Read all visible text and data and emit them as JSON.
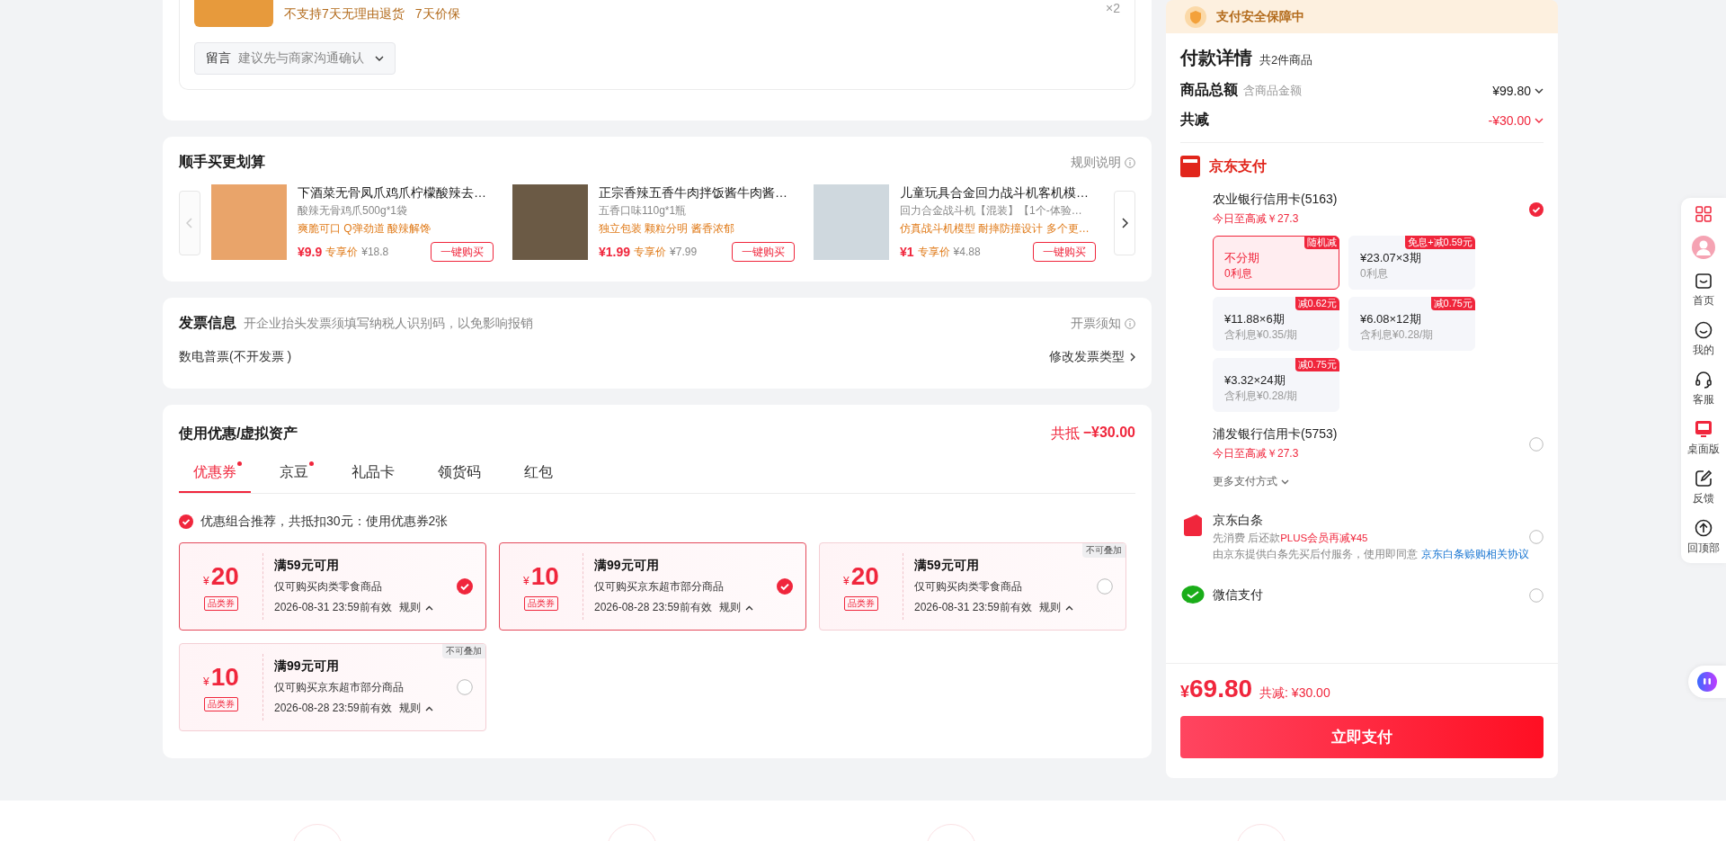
{
  "order_item": {
    "notice": "不支持7天无理由退货",
    "guarantee": "7天价保",
    "quantity": "×2",
    "remark": {
      "label": "留言",
      "placeholder": "建议先与商家沟通确认"
    }
  },
  "addon_deals": {
    "title": "顺手买更划算",
    "rules": "规则说明",
    "prev_enabled": false,
    "next_enabled": true,
    "products": [
      {
        "name": "下酒菜无骨凤爪鸡爪柠檬酸辣去…",
        "spec": "酸辣无骨鸡爪500g*1袋",
        "tags": "爽脆可口 Q弹劲道 酸辣解馋",
        "price": "¥9.9",
        "member_label": "专享价",
        "member_price": "¥18.8",
        "button": "一键购买"
      },
      {
        "name": "正宗香辣五香牛肉拌饭酱牛肉酱…",
        "spec": "五香口味110g*1瓶",
        "tags": "独立包装 颗粒分明 酱香浓郁",
        "price": "¥1.99",
        "member_label": "专享价",
        "member_price": "¥7.99",
        "button": "一键购买"
      },
      {
        "name": "儿童玩具合金回力战斗机客机模…",
        "spec": "回力合金战斗机【混装】【1个-体验…",
        "tags": "仿真战斗机模型 耐摔防撞设计 多个更…",
        "price": "¥1",
        "member_label": "专享价",
        "member_price": "¥4.88",
        "button": "一键购买"
      }
    ]
  },
  "invoice": {
    "title": "发票信息",
    "hint": "开企业抬头发票须填写纳税人识别码，以免影响报销",
    "notice": "开票须知",
    "type": "数电普票(不开发票 )",
    "change": "修改发票类型"
  },
  "discounts": {
    "title": "使用优惠/虚拟资产",
    "total_label": "共抵",
    "total": "−¥30.00",
    "tabs": [
      {
        "label": "优惠券",
        "selected": true,
        "dot": true
      },
      {
        "label": "京豆",
        "selected": false,
        "dot": true
      },
      {
        "label": "礼品卡",
        "selected": false,
        "dot": false
      },
      {
        "label": "领货码",
        "selected": false,
        "dot": false
      },
      {
        "label": "红包",
        "selected": false,
        "dot": false
      }
    ],
    "recommendation": {
      "text": "优惠组合推荐，共抵扣30元：使用优惠券2张",
      "checked": true
    },
    "coupons": [
      {
        "currency": "¥",
        "amount": "20",
        "category": "品类券",
        "condition": "满59元可用",
        "scope": "仅可购买肉类零食商品",
        "expiry": "2026-08-31 23:59前有效",
        "rule": "规则",
        "selected": true
      },
      {
        "currency": "¥",
        "amount": "10",
        "category": "品类券",
        "condition": "满99元可用",
        "scope": "仅可购买京东超市部分商品",
        "expiry": "2026-08-28 23:59前有效",
        "rule": "规则",
        "selected": true
      },
      {
        "currency": "¥",
        "amount": "20",
        "category": "品类券",
        "condition": "满59元可用",
        "scope": "仅可购买肉类零食商品",
        "expiry": "2026-08-31 23:59前有效",
        "rule": "规则",
        "selected": false,
        "tag": "不可叠加"
      },
      {
        "currency": "¥",
        "amount": "10",
        "category": "品类券",
        "condition": "满99元可用",
        "scope": "仅可购买京东超市部分商品",
        "expiry": "2026-08-28 23:59前有效",
        "rule": "规则",
        "selected": false,
        "tag": "不可叠加"
      }
    ]
  },
  "payment": {
    "security": "支付安全保障中",
    "title": "付款详情",
    "count": "共2件商品",
    "subtotal": {
      "label": "商品总额",
      "hint": "含商品金额",
      "value": "¥99.80"
    },
    "reduction": {
      "label": "共减",
      "value": "-¥30.00"
    },
    "jd_pay": {
      "title": "京东支付",
      "cards": [
        {
          "name": "农业银行信用卡(5163)",
          "promo": "今日至高减￥27.3",
          "selected": true,
          "plans": [
            {
              "title": "不分期",
              "subtitle": "0利息",
              "badge": "随机减",
              "selected": true
            },
            {
              "title": "¥23.07×3期",
              "subtitle": "0利息",
              "badge": "免息+减0.59元",
              "selected": false
            },
            {
              "title": "¥11.88×6期",
              "subtitle": "含利息¥0.35/期",
              "badge": "减0.62元",
              "selected": false
            },
            {
              "title": "¥6.08×12期",
              "subtitle": "含利息¥0.28/期",
              "badge": "减0.75元",
              "selected": false
            },
            {
              "title": "¥3.32×24期",
              "subtitle": "含利息¥0.28/期",
              "badge": "减0.75元",
              "selected": false
            }
          ]
        },
        {
          "name": "浦发银行信用卡(5753)",
          "promo": "今日至高减￥27.3",
          "selected": false
        }
      ],
      "more": "更多支付方式"
    },
    "methods": [
      {
        "kind": "baitiao",
        "name": "京东白条",
        "intro": "先消费 后还款",
        "promo": "PLUS会员再减¥45",
        "terms": "由京东提供白条先买后付服务，使用即同意",
        "link": "京东白条赊购相关协议",
        "selected": false
      },
      {
        "kind": "wechat",
        "name": "微信支付",
        "selected": false
      }
    ],
    "total": {
      "currency": "¥",
      "amount": "69.80",
      "saving": "共减: ¥30.00"
    },
    "pay_button": "立即支付"
  },
  "tools": [
    {
      "kind": "grid"
    },
    {
      "kind": "avatar"
    },
    {
      "kind": "home",
      "label": "首页"
    },
    {
      "kind": "me",
      "label": "我的"
    },
    {
      "kind": "service",
      "label": "客服"
    },
    {
      "kind": "desktop",
      "label": "桌面版"
    },
    {
      "kind": "feedback",
      "label": "反馈"
    },
    {
      "kind": "top",
      "label": "回顶部"
    }
  ]
}
